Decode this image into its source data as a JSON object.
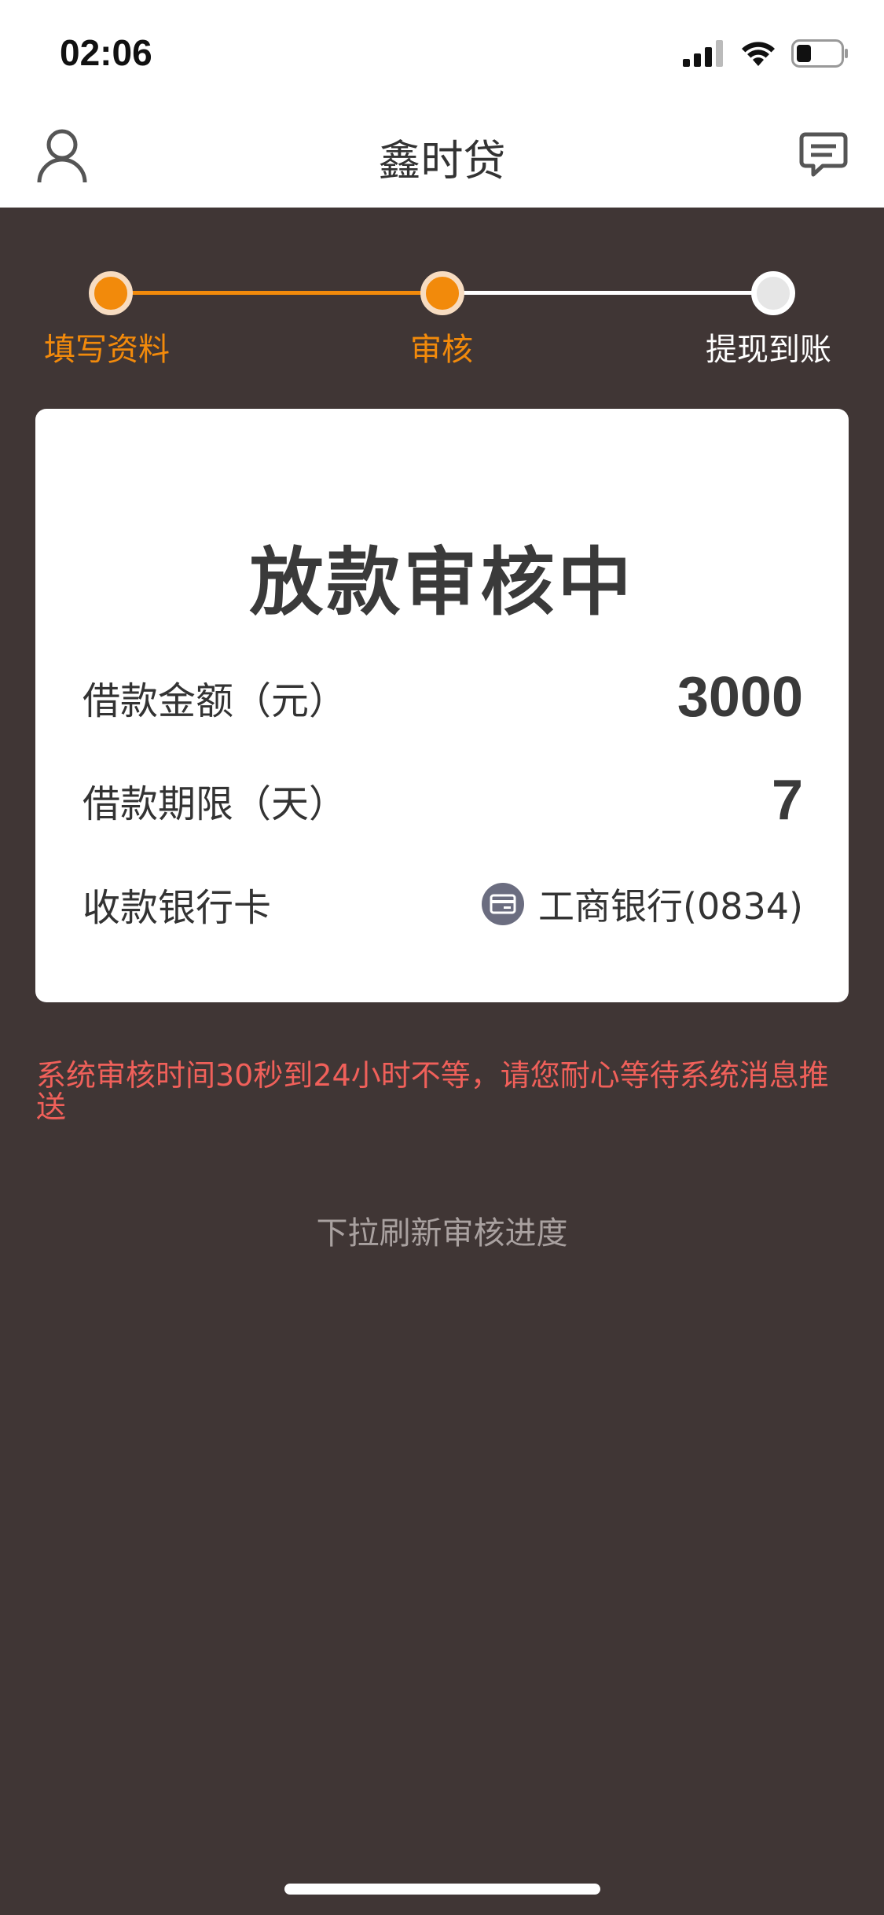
{
  "status_bar": {
    "time": "02:06",
    "icons": [
      "signal-icon",
      "wifi-icon",
      "battery-icon"
    ]
  },
  "nav": {
    "title": "鑫时贷",
    "left_icon": "user-icon",
    "right_icon": "message-icon"
  },
  "stepper": {
    "steps": [
      {
        "label": "填写资料",
        "state": "done"
      },
      {
        "label": "审核",
        "state": "current"
      },
      {
        "label": "提现到账",
        "state": "pending"
      }
    ],
    "active_color": "#f28a0b",
    "inactive_color": "#ffffff"
  },
  "card": {
    "title": "放款审核中",
    "rows": [
      {
        "label": "借款金额（元）",
        "value": "3000"
      },
      {
        "label": "借款期限（天）",
        "value": "7"
      },
      {
        "label": "收款银行卡",
        "value": "工商银行(0834)",
        "icon": "bank-card-icon"
      }
    ]
  },
  "notice": "系统审核时间30秒到24小时不等，请您耐心等待系统消息推送",
  "refresh_hint": "下拉刷新审核进度",
  "colors": {
    "background": "#403635",
    "accent": "#f28a0b",
    "notice": "#f0605a"
  }
}
